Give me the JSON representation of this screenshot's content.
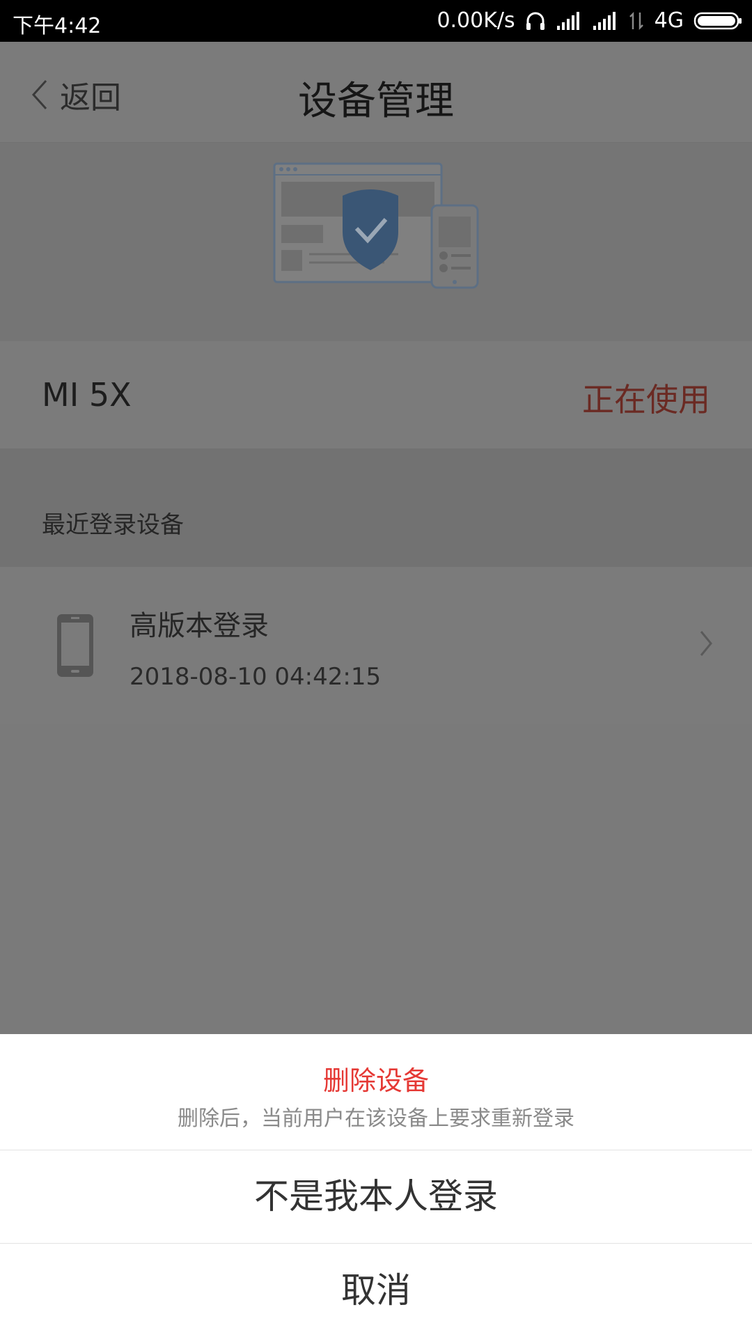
{
  "status_bar": {
    "time": "下午4:42",
    "net_speed": "0.00K/s",
    "network": "4G"
  },
  "header": {
    "back_label": "返回",
    "title": "设备管理"
  },
  "current_device": {
    "name": "MI 5X",
    "status": "正在使用"
  },
  "recent": {
    "section_label": "最近登录设备",
    "items": [
      {
        "name": "高版本登录",
        "time": "2018-08-10 04:42:15"
      }
    ]
  },
  "sheet": {
    "title": "删除设备",
    "subtitle": "删除后，当前用户在该设备上要求重新登录",
    "option1": "不是我本人登录",
    "cancel": "取消"
  },
  "colors": {
    "overlay": "#7a7a7a",
    "danger": "#e53935",
    "status_active": "#6b2a23",
    "shield": "#3a5675"
  }
}
